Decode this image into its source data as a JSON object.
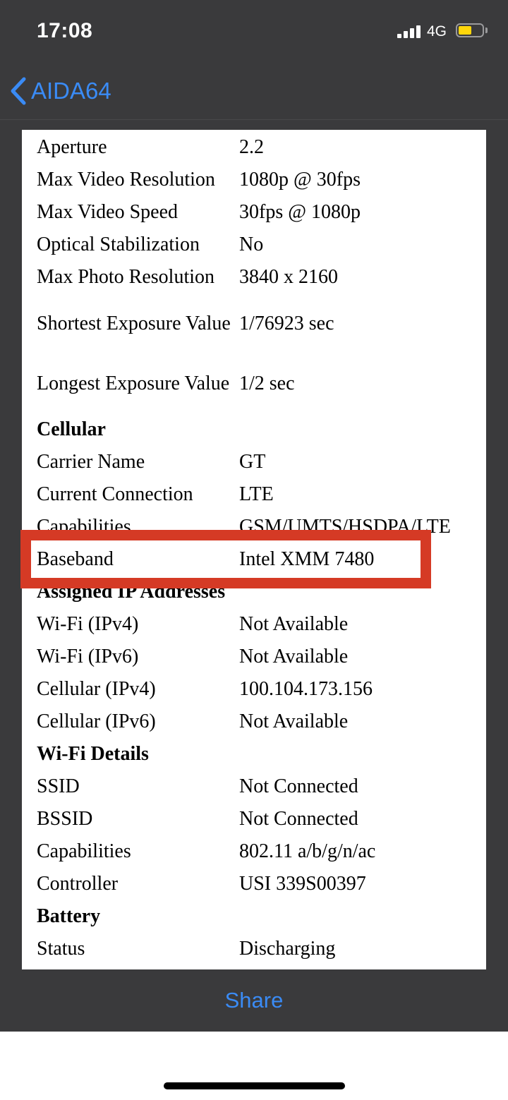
{
  "status_bar": {
    "time": "17:08",
    "network": "4G",
    "battery_level": 0.58,
    "battery_color": "#ffd60a"
  },
  "nav": {
    "back_label": "AIDA64",
    "accent_color": "#3a8bf5"
  },
  "rows": [
    {
      "key": "Aperture",
      "value": "2.2"
    },
    {
      "key": "Max Video Resolution",
      "value": "1080p @ 30fps"
    },
    {
      "key": "Max Video Speed",
      "value": "30fps @ 1080p"
    },
    {
      "key": "Optical Stabilization",
      "value": "No"
    },
    {
      "key": "Max Photo Resolution",
      "value": "3840 x 2160"
    },
    {
      "key": "Shortest Exposure Value",
      "value": "1/76923 sec"
    },
    {
      "key": "Longest Exposure Value",
      "value": "1/2 sec"
    },
    {
      "section": "Cellular"
    },
    {
      "key": "Carrier Name",
      "value": "GT"
    },
    {
      "key": "Current Connection",
      "value": "LTE"
    },
    {
      "key": "Capabilities",
      "value": "GSM/UMTS/HSDPA/LTE"
    },
    {
      "key": "Baseband",
      "value": "Intel XMM 7480"
    },
    {
      "section": "Assigned IP Addresses"
    },
    {
      "key": "Wi-Fi (IPv4)",
      "value": "Not Available"
    },
    {
      "key": "Wi-Fi (IPv6)",
      "value": "Not Available"
    },
    {
      "key": "Cellular (IPv4)",
      "value": "100.104.173.156"
    },
    {
      "key": "Cellular (IPv6)",
      "value": "Not Available"
    },
    {
      "section": "Wi-Fi Details"
    },
    {
      "key": "SSID",
      "value": "Not Connected"
    },
    {
      "key": "BSSID",
      "value": "Not Connected"
    },
    {
      "key": "Capabilities",
      "value": "802.11 a/b/g/n/ac"
    },
    {
      "key": "Controller",
      "value": "USI 339S00397"
    },
    {
      "section": "Battery"
    },
    {
      "key": "Status",
      "value": "Discharging"
    }
  ],
  "highlight_color": "#d53a25",
  "share_label": "Share"
}
